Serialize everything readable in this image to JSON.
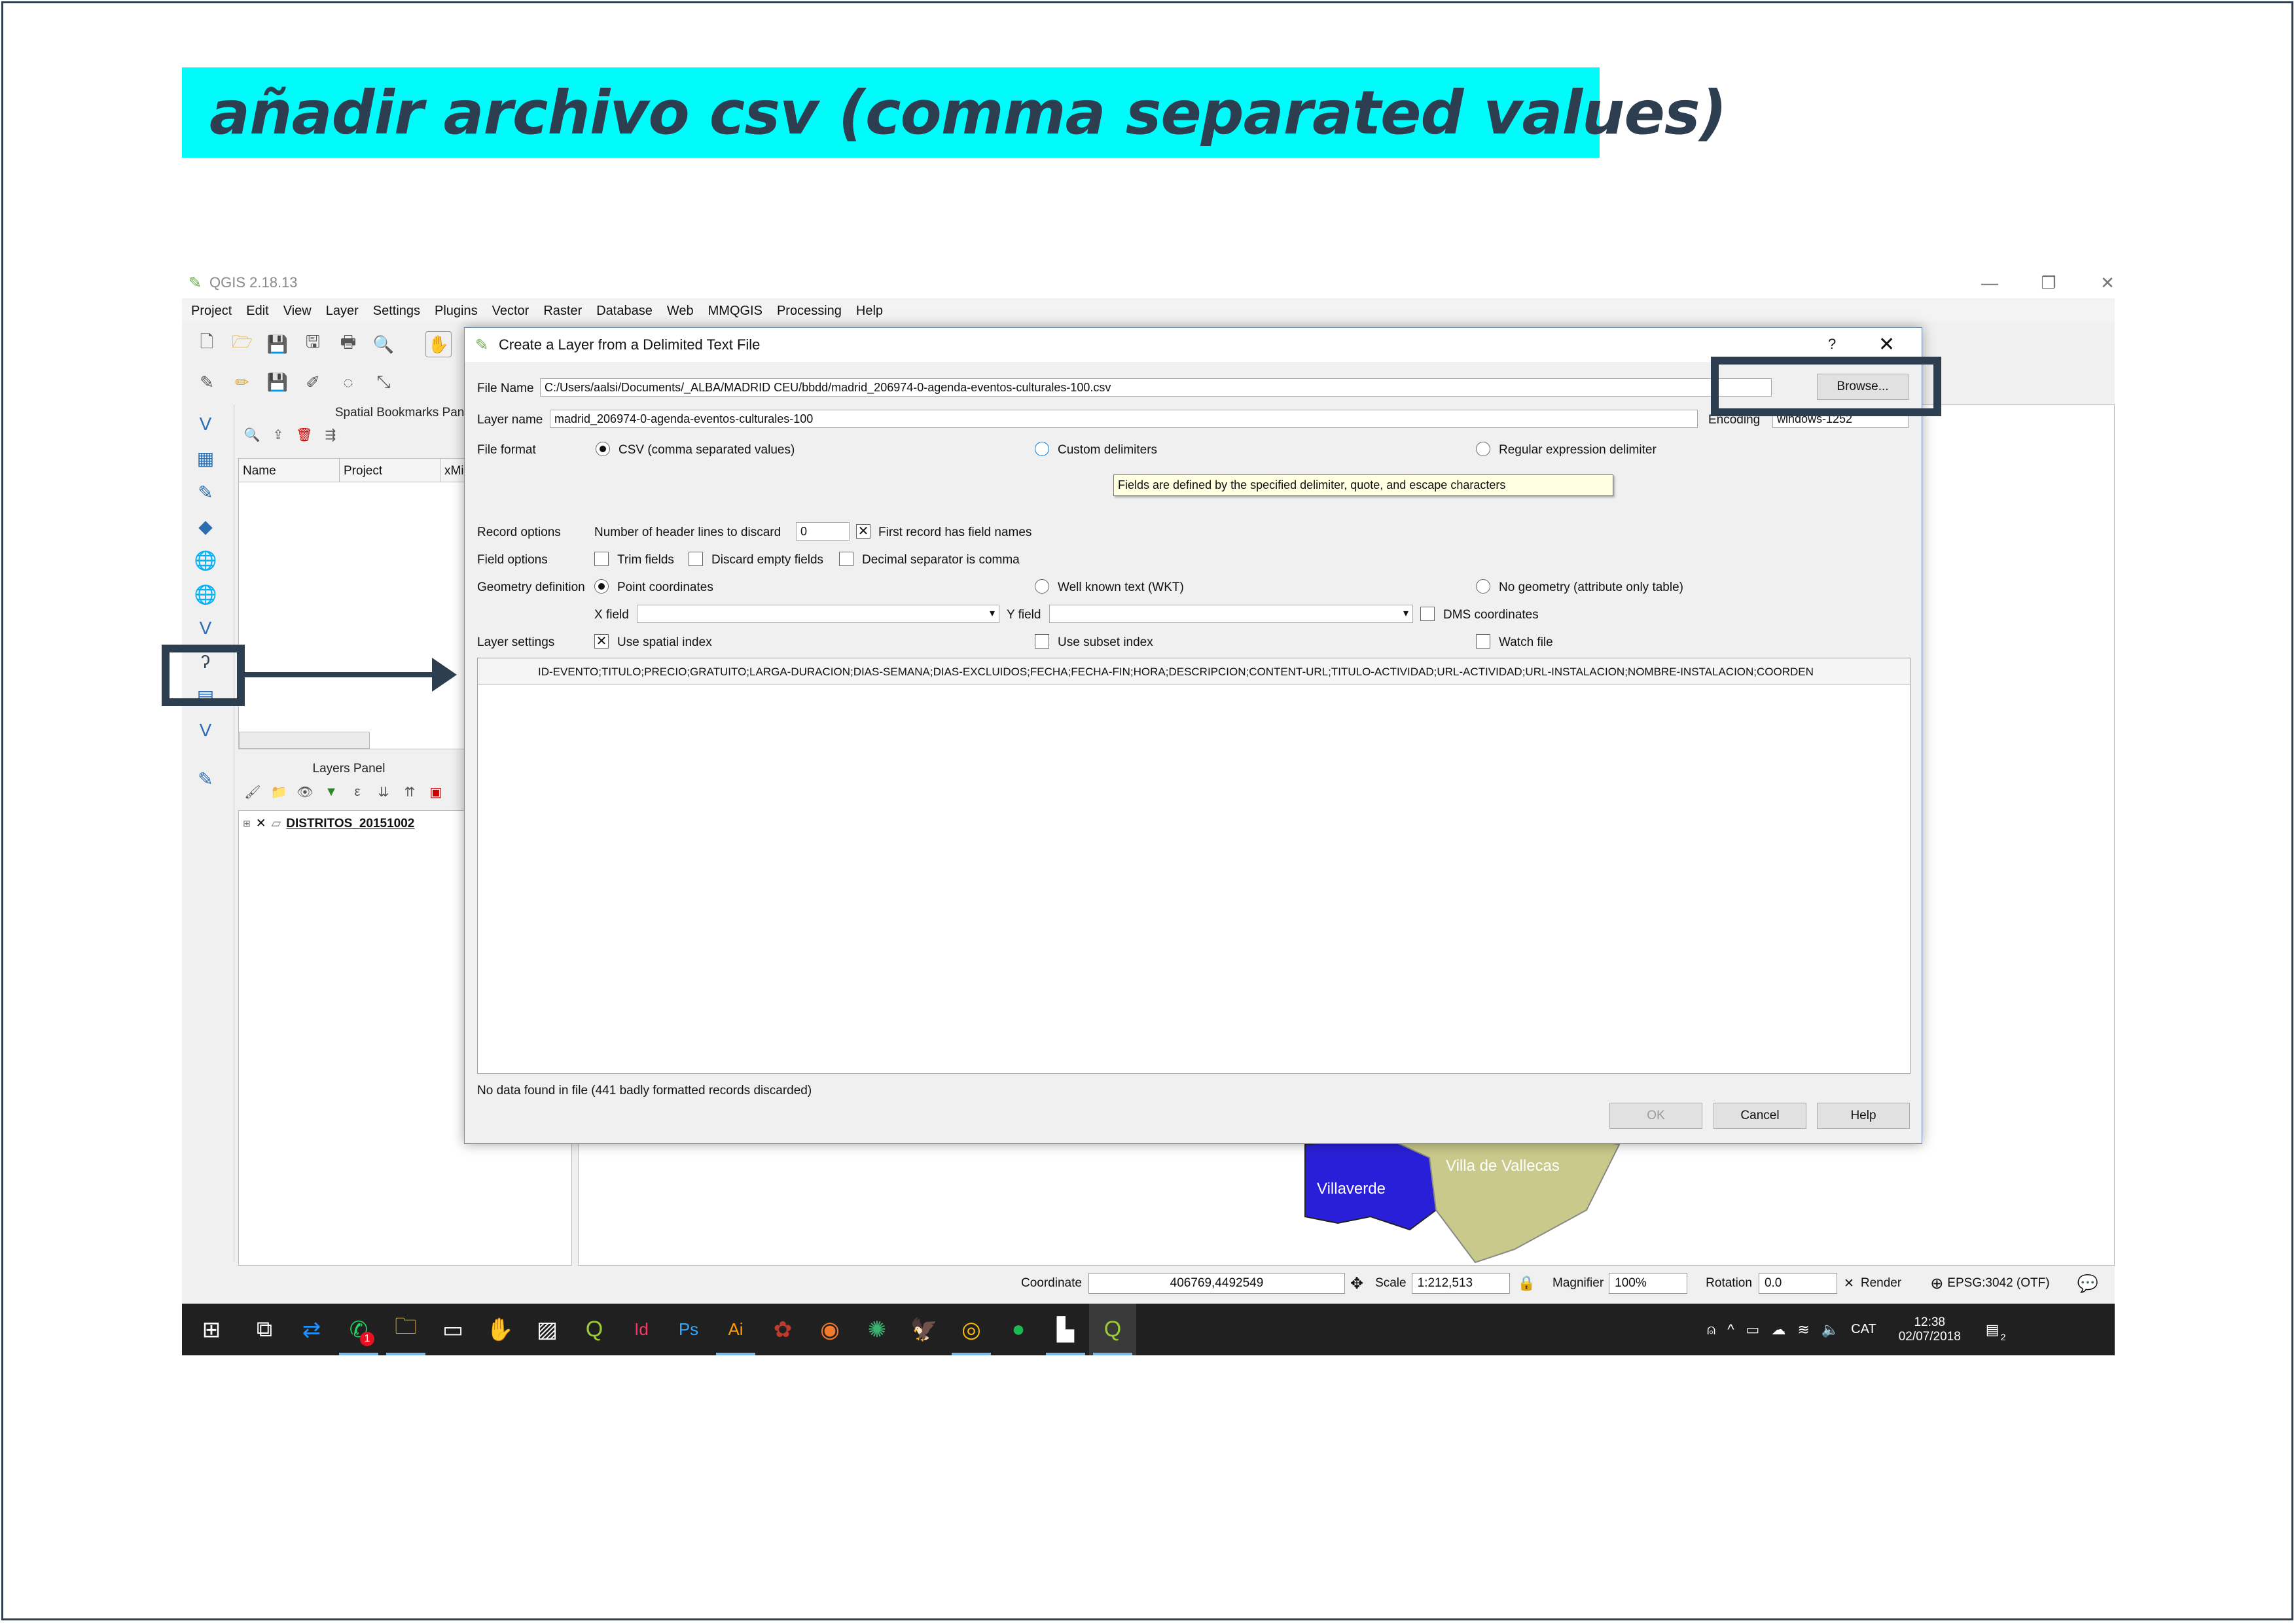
{
  "slide_title": "añadir archivo csv (comma separated values)",
  "app": {
    "title": "QGIS 2.18.13",
    "menu": [
      "Project",
      "Edit",
      "View",
      "Layer",
      "Settings",
      "Plugins",
      "Vector",
      "Raster",
      "Database",
      "Web",
      "MMQGIS",
      "Processing",
      "Help"
    ]
  },
  "bookmarks_panel": {
    "title": "Spatial Bookmarks Panel",
    "columns": [
      "Name",
      "Project",
      "xMi"
    ]
  },
  "layers_panel": {
    "title": "Layers Panel",
    "layer_name": "DISTRITOS_20151002"
  },
  "map": {
    "labels": [
      "Villaverde",
      "Villa de Vallecas"
    ],
    "colors": {
      "villaverde": "#2a1fd8",
      "vallecas": "#c8c98a"
    }
  },
  "dialog": {
    "title": "Create a Layer from a Delimited Text File",
    "help_glyph": "?",
    "file_name_label": "File Name",
    "file_name_value": "C:/Users/aalsi/Documents/_ALBA/MADRID CEU/bbdd/madrid_206974-0-agenda-eventos-culturales-100.csv",
    "browse_label": "Browse...",
    "layer_name_label": "Layer name",
    "layer_name_value": "madrid_206974-0-agenda-eventos-culturales-100",
    "encoding_label": "Encoding",
    "encoding_value": "windows-1252",
    "file_format_label": "File format",
    "format_options": [
      "CSV (comma separated values)",
      "Custom delimiters",
      "Regular expression delimiter"
    ],
    "tooltip": "Fields are defined by the specified delimiter, quote, and escape characters",
    "record_options_label": "Record options",
    "header_lines_label": "Number of header lines to discard",
    "header_lines_value": "0",
    "first_record_label": "First record has field names",
    "field_options_label": "Field options",
    "field_options": [
      "Trim fields",
      "Discard empty fields",
      "Decimal separator is comma"
    ],
    "geometry_label": "Geometry definition",
    "geometry_options": [
      "Point coordinates",
      "Well known text (WKT)",
      "No geometry (attribute only table)"
    ],
    "x_field_label": "X field",
    "y_field_label": "Y field",
    "dms_label": "DMS coordinates",
    "layer_settings_label": "Layer settings",
    "layer_settings": [
      "Use spatial index",
      "Use subset index",
      "Watch file"
    ],
    "preview_header": "ID-EVENTO;TITULO;PRECIO;GRATUITO;LARGA-DURACION;DIAS-SEMANA;DIAS-EXCLUIDOS;FECHA;FECHA-FIN;HORA;DESCRIPCION;CONTENT-URL;TITULO-ACTIVIDAD;URL-ACTIVIDAD;URL-INSTALACION;NOMBRE-INSTALACION;COORDEN",
    "status_message": "No data found in file (441 badly formatted records discarded)",
    "ok_label": "OK",
    "cancel_label": "Cancel",
    "help_label": "Help"
  },
  "statusbar": {
    "coordinate_label": "Coordinate",
    "coordinate_value": "406769,4492549",
    "scale_label": "Scale",
    "scale_value": "1:212,513",
    "magnifier_label": "Magnifier",
    "magnifier_value": "100%",
    "rotation_label": "Rotation",
    "rotation_value": "0.0",
    "render_label": "Render",
    "crs": "EPSG:3042 (OTF)"
  },
  "taskbar": {
    "lang": "CAT",
    "time": "12:38",
    "date": "02/07/2018",
    "notif_count": "2",
    "whatsapp_badge": "1"
  },
  "accent_colors": {
    "banner": "#00fbfb",
    "annotation": "#2c3e50"
  }
}
